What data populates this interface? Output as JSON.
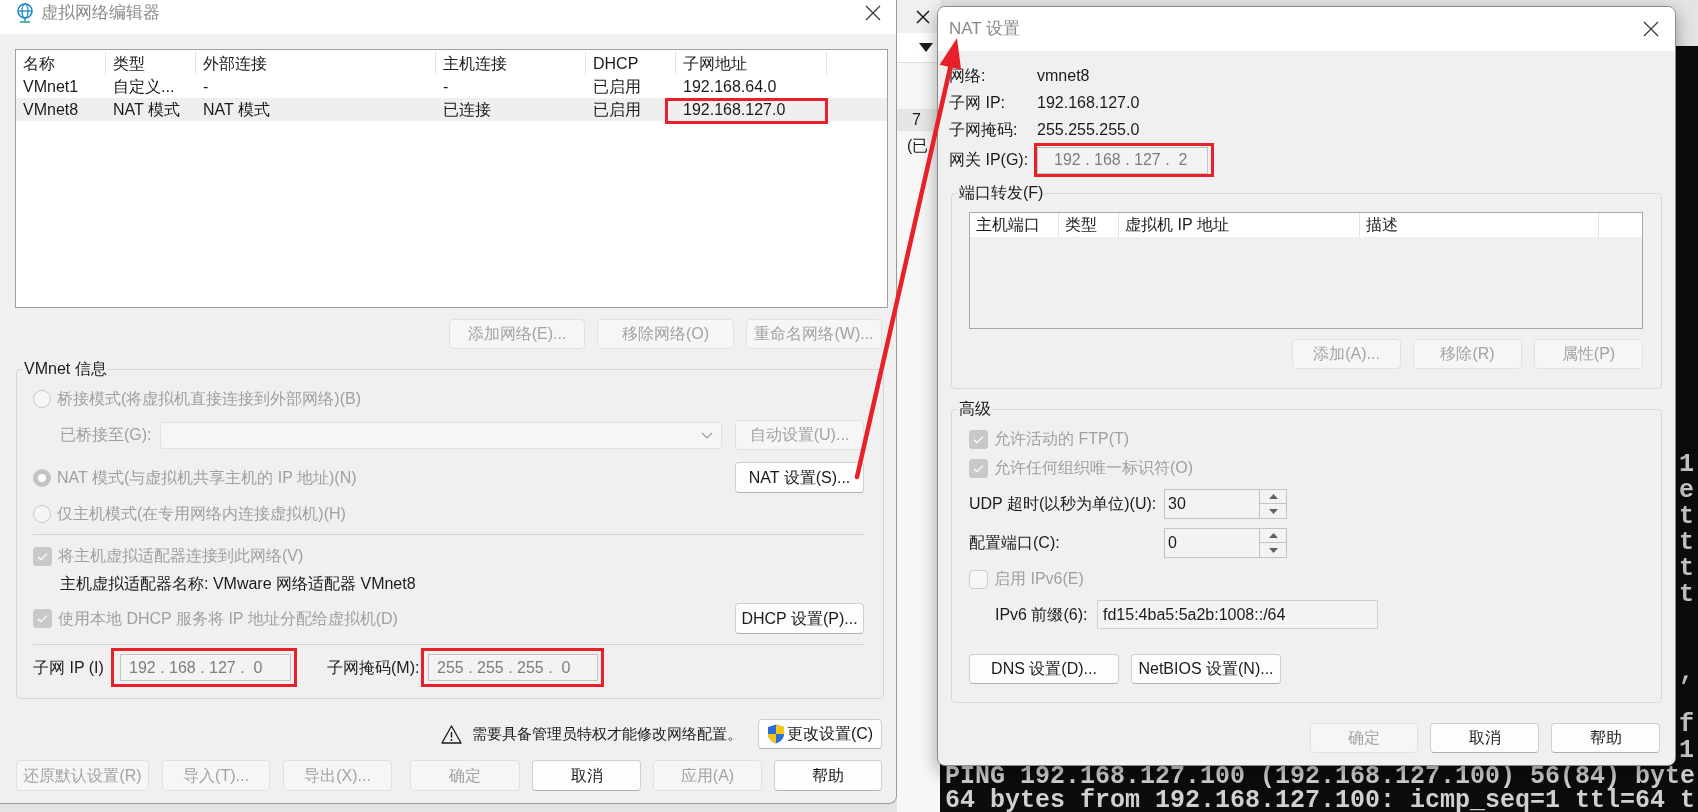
{
  "editor": {
    "title": "虚拟网络编辑器",
    "networks": {
      "columns": [
        "名称",
        "类型",
        "外部连接",
        "主机连接",
        "DHCP",
        "子网地址"
      ],
      "rows": [
        {
          "name": "VMnet1",
          "type": "自定义...",
          "external": "-",
          "host": "-",
          "dhcp": "已启用",
          "subnet": "192.168.64.0",
          "selected": false,
          "subnet_highlighted": false
        },
        {
          "name": "VMnet8",
          "type": "NAT 模式",
          "external": "NAT 模式",
          "host": "已连接",
          "dhcp": "已启用",
          "subnet": "192.168.127.0",
          "selected": true,
          "subnet_highlighted": true
        }
      ]
    },
    "list_buttons": [
      {
        "label": "添加网络(E)...",
        "disabled": true
      },
      {
        "label": "移除网络(O)",
        "disabled": true
      },
      {
        "label": "重命名网络(W)...",
        "disabled": true
      }
    ],
    "vmnet_info": {
      "title": "VMnet 信息",
      "modes": [
        {
          "label": "桥接模式(将虚拟机直接连接到外部网络)(B)",
          "selected": false,
          "disabled": true
        },
        {
          "label": "NAT 模式(与虚拟机共享主机的 IP 地址)(N)",
          "selected": true,
          "disabled": true
        },
        {
          "label": "仅主机模式(在专用网络内连接虚拟机)(H)",
          "selected": false,
          "disabled": true
        }
      ],
      "bridged_to": {
        "label": "已桥接至(G):",
        "disabled": true
      },
      "auto_settings": {
        "label": "自动设置(U)...",
        "disabled": true
      },
      "nat_settings": {
        "label": "NAT 设置(S)...",
        "disabled": false
      },
      "connect_adapter": {
        "label": "将主机虚拟适配器连接到此网络(V)",
        "checked": true,
        "disabled": true
      },
      "adapter_name": "主机虚拟适配器名称: VMware 网络适配器 VMnet8",
      "use_dhcp": {
        "label": "使用本地 DHCP 服务将 IP 地址分配给虚拟机(D)",
        "checked": true,
        "disabled": true
      },
      "dhcp_settings": {
        "label": "DHCP 设置(P)...",
        "disabled": false
      },
      "subnet_ip": {
        "label": "子网 IP (I)",
        "value": "192 . 168 . 127 .  0",
        "highlighted": true
      },
      "subnet_mask": {
        "label": "子网掩码(M):",
        "value": "255 . 255 . 255 .  0",
        "highlighted": true
      }
    },
    "admin_notice": "需要具备管理员特权才能修改网络配置。",
    "change_settings": {
      "label": "更改设置(C)",
      "disabled": false
    },
    "buttons": [
      {
        "label": "还原默认设置(R)",
        "disabled": true
      },
      {
        "label": "导入(T)...",
        "disabled": true
      },
      {
        "label": "导出(X)...",
        "disabled": true
      },
      {
        "label": "确定",
        "disabled": true
      },
      {
        "label": "取消",
        "disabled": false
      },
      {
        "label": "应用(A)",
        "disabled": true
      },
      {
        "label": "帮助",
        "disabled": false
      }
    ]
  },
  "background_window": {
    "texts": [
      "7",
      "(已"
    ]
  },
  "nat_dialog": {
    "title": "NAT 设置",
    "info": [
      {
        "label": "网络:",
        "value": "vmnet8"
      },
      {
        "label": "子网 IP:",
        "value": "192.168.127.0"
      },
      {
        "label": "子网掩码:",
        "value": "255.255.255.0"
      }
    ],
    "gateway": {
      "label": "网关 IP(G):",
      "value": "192 . 168 . 127 .  2",
      "highlighted": true
    },
    "port_forwarding": {
      "title": "端口转发(F)",
      "columns": [
        "主机端口",
        "类型",
        "虚拟机 IP 地址",
        "描述"
      ],
      "buttons": [
        {
          "label": "添加(A)...",
          "disabled": true
        },
        {
          "label": "移除(R)",
          "disabled": true
        },
        {
          "label": "属性(P)",
          "disabled": true
        }
      ]
    },
    "advanced": {
      "title": "高级",
      "options": [
        {
          "label": "允许活动的 FTP(T)",
          "checked": true,
          "disabled": true
        },
        {
          "label": "允许任何组织唯一标识符(O)",
          "checked": true,
          "disabled": true
        }
      ],
      "udp_timeout": {
        "label": "UDP 超时(以秒为单位)(U):",
        "value": "30"
      },
      "config_port": {
        "label": "配置端口(C):",
        "value": "0"
      },
      "enable_ipv6": {
        "label": "启用 IPv6(E)",
        "checked": false,
        "disabled": true
      },
      "ipv6_prefix": {
        "label": "IPv6 前缀(6):",
        "value": "fd15:4ba5:5a2b:1008::/64"
      },
      "buttons": [
        {
          "label": "DNS 设置(D)...",
          "disabled": false
        },
        {
          "label": "NetBIOS 设置(N)...",
          "disabled": false
        }
      ]
    },
    "buttons": [
      {
        "label": "确定",
        "disabled": true
      },
      {
        "label": "取消",
        "disabled": false
      },
      {
        "label": "帮助",
        "disabled": false
      }
    ]
  },
  "terminal": {
    "fragment_blocks": [
      {
        "lines": [
          "1",
          "e",
          "t",
          "t",
          "t",
          "t"
        ]
      },
      {
        "lines": [
          ","
        ]
      },
      {
        "lines": [
          "f",
          "1"
        ]
      }
    ],
    "lines": [
      "PING 192.168.127.100 (192.168.127.100) 56(84) byte",
      "64 bytes from 192.168.127.100: icmp_seq=1 ttl=64 t"
    ]
  }
}
